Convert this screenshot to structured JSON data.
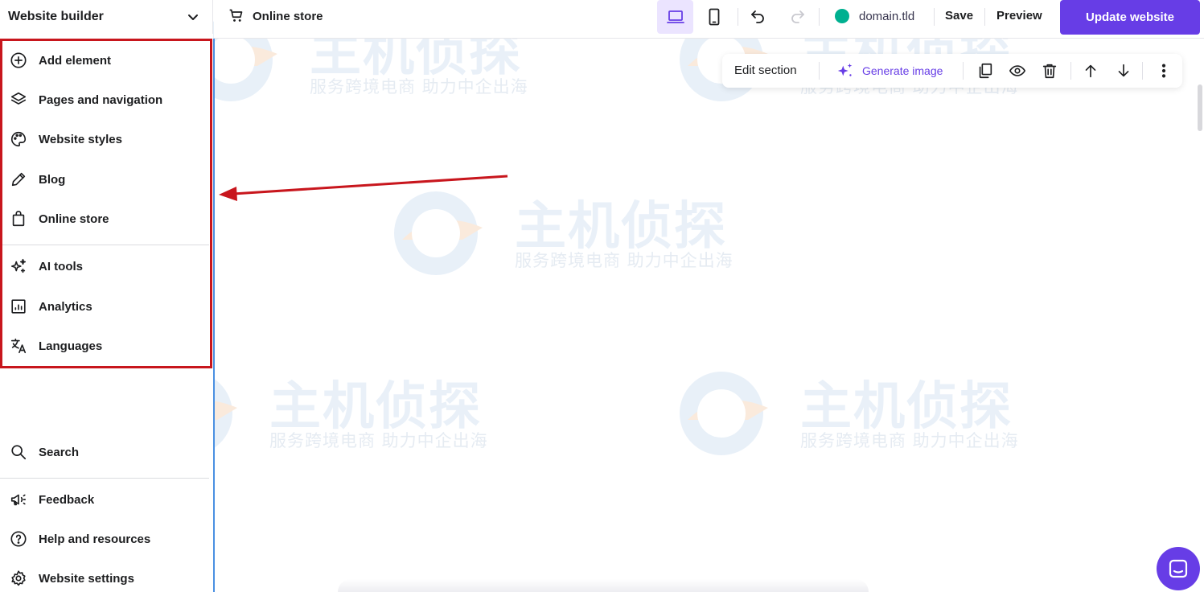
{
  "sidebar": {
    "title": "Website builder",
    "items": [
      {
        "label": "Add element"
      },
      {
        "label": "Pages and navigation"
      },
      {
        "label": "Website styles"
      },
      {
        "label": "Blog"
      },
      {
        "label": "Online store"
      },
      {
        "label": "AI tools"
      },
      {
        "label": "Analytics"
      },
      {
        "label": "Languages"
      }
    ],
    "bottom": [
      {
        "label": "Search"
      },
      {
        "label": "Feedback"
      },
      {
        "label": "Help and resources"
      },
      {
        "label": "Website settings"
      }
    ]
  },
  "topbar": {
    "store_label": "Online store",
    "domain": "domain.tld",
    "save_label": "Save",
    "preview_label": "Preview",
    "update_label": "Update website"
  },
  "section_toolbar": {
    "edit_label": "Edit section",
    "generate_label": "Generate image"
  },
  "watermark": {
    "title": "主机侦探",
    "subtitle": "服务跨境电商 助力中企出海"
  },
  "colors": {
    "accent": "#673de6",
    "highlight": "#c8161d",
    "domain_status": "#00b090"
  }
}
